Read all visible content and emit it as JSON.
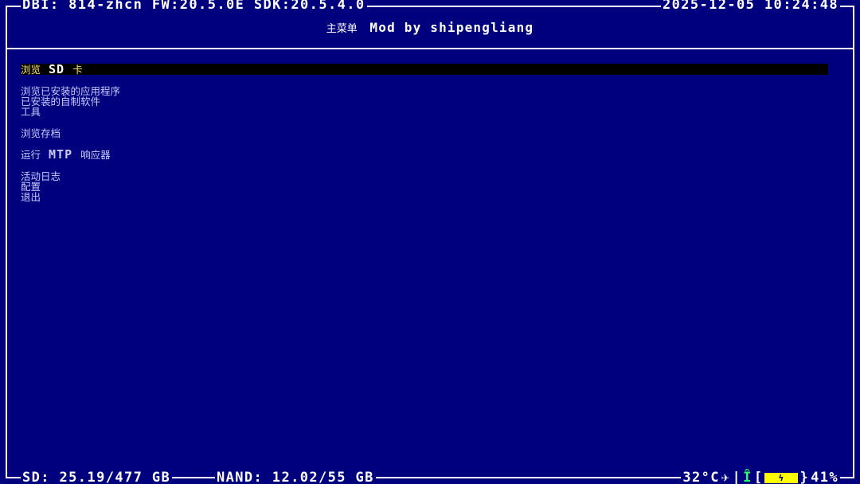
{
  "header": {
    "left": "DBI: 814-zhcn FW:20.5.0E SDK:20.5.4.0",
    "right": "2025-12-05 10:24:48",
    "title_cn": "主菜单",
    "title_mod": "Mod by shipengliang"
  },
  "menu": {
    "items": [
      {
        "pre": "浏览",
        "big": "SD",
        "post": "卡"
      },
      {
        "label": "浏览已安装的应用程序"
      },
      {
        "label": "已安装的自制软件"
      },
      {
        "label": "工具"
      },
      {
        "label": "浏览存档"
      },
      {
        "pre": "运行",
        "big": "MTP",
        "post": "响应器"
      },
      {
        "label": "活动日志"
      },
      {
        "label": "配置"
      },
      {
        "label": "退出"
      }
    ],
    "selected_index": 0
  },
  "footer": {
    "sd": "SD: 25.19/477 GB",
    "nand": "NAND: 12.02/55 GB",
    "temp": "32°C",
    "airplane_icon": "✈",
    "wifi_icon": "Î",
    "battery_open": "[",
    "battery_glyph": "ϟ",
    "battery_close": "}",
    "battery_percent": "41%"
  },
  "colors": {
    "background": "#00007e",
    "selected_bg": "#000000",
    "selected_text": "#ffe86a",
    "battery": "#ffff00"
  }
}
